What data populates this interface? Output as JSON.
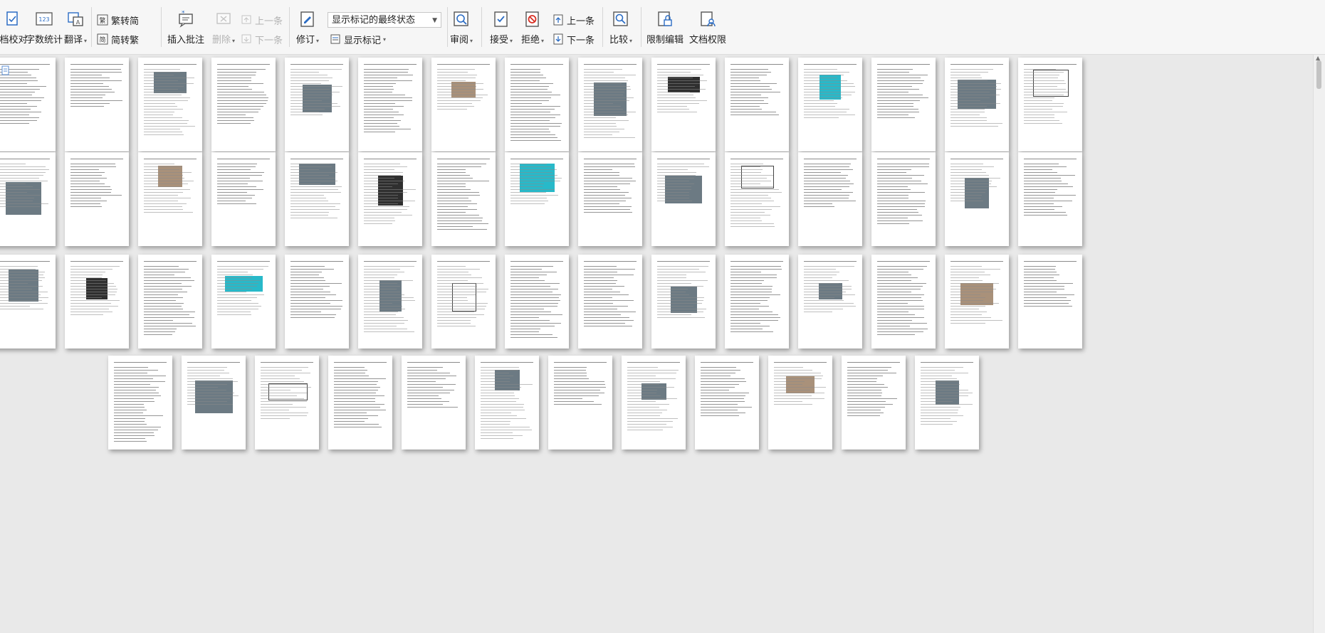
{
  "toolbar": {
    "proofread_label": "档校对",
    "word_count_label": "字数统计",
    "translate_label": "翻译",
    "trad_label": "繁转简",
    "simp_label": "简转繁",
    "insert_comment_label": "插入批注",
    "delete_label": "删除",
    "prev_comment_label": "上一条",
    "next_comment_label": "下一条",
    "revise_label": "修订",
    "markup_state_value": "显示标记的最终状态",
    "show_markup_label": "显示标记",
    "review_pane_label": "审阅",
    "accept_label": "接受",
    "reject_label": "拒绝",
    "prev_change_label": "上一条",
    "next_change_label": "下一条",
    "compare_label": "比较",
    "restrict_edit_label": "限制编辑",
    "doc_permission_label": "文档权限"
  },
  "colors": {
    "accent": "#2b6cc4",
    "reject": "#d93025"
  }
}
